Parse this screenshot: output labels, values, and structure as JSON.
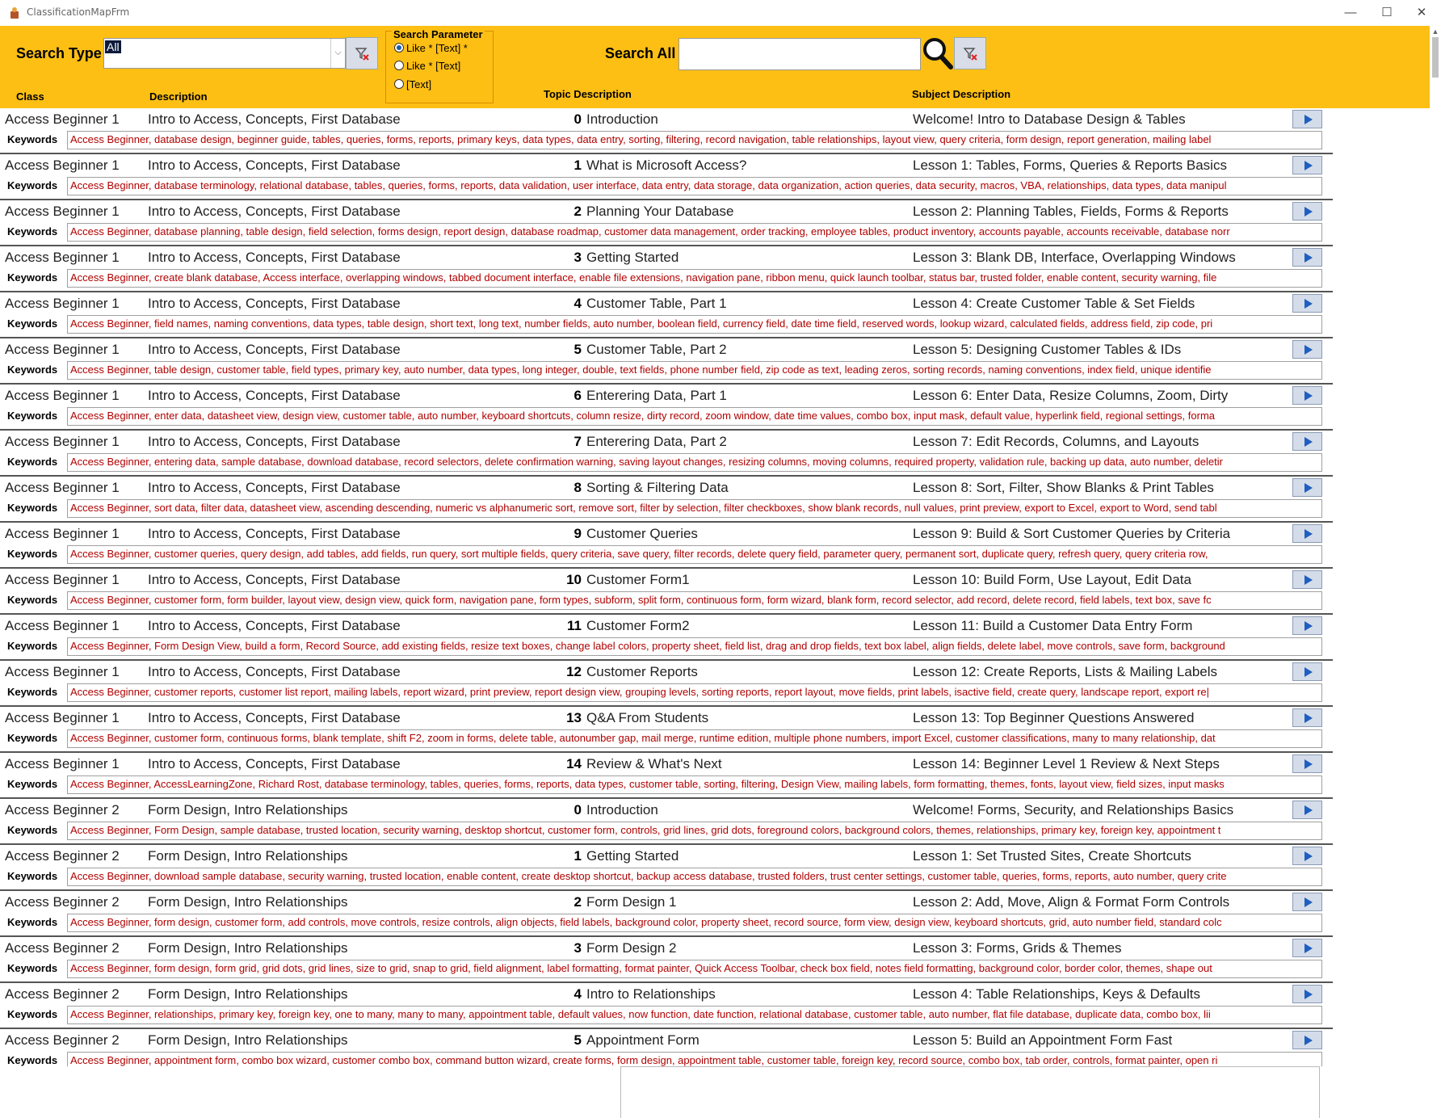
{
  "window": {
    "title": "ClassificationMapFrm",
    "minimize": "—",
    "maximize": "☐",
    "close": "✕"
  },
  "search": {
    "type_label": "Search Type",
    "type_value": "All",
    "param_title": "Search Parameter",
    "options": [
      "Like * [Text] *",
      "Like * [Text]",
      "[Text]"
    ],
    "selected_option": 0,
    "all_label": "Search All",
    "all_value": ""
  },
  "columns": {
    "class": "Class",
    "description": "Description",
    "topic": "Topic Description",
    "subject": "Subject Description"
  },
  "keywords_label": "Keywords",
  "records": [
    {
      "class": "Access Beginner 1",
      "desc": "Intro to Access, Concepts, First Database",
      "num": "0",
      "topic": "Introduction",
      "subject": "Welcome! Intro to Database Design & Tables",
      "keywords": "Access Beginner, database design, beginner guide, tables, queries, forms, reports, primary keys, data types, data entry, sorting, filtering, record navigation, table relationships, layout view, query criteria, form design, report generation, mailing label"
    },
    {
      "class": "Access Beginner 1",
      "desc": "Intro to Access, Concepts, First Database",
      "num": "1",
      "topic": "What is Microsoft Access?",
      "subject": "Lesson 1: Tables, Forms, Queries & Reports Basics",
      "keywords": "Access Beginner, database terminology, relational database, tables, queries, forms, reports, data validation, user interface, data entry, data storage, data organization, action queries, data security, macros, VBA, relationships, data types, data manipul"
    },
    {
      "class": "Access Beginner 1",
      "desc": "Intro to Access, Concepts, First Database",
      "num": "2",
      "topic": "Planning Your Database",
      "subject": "Lesson 2: Planning Tables, Fields, Forms & Reports",
      "keywords": "Access Beginner, database planning, table design, field selection, forms design, report design, database roadmap, customer data management, order tracking, employee tables, product inventory, accounts payable, accounts receivable, database norr"
    },
    {
      "class": "Access Beginner 1",
      "desc": "Intro to Access, Concepts, First Database",
      "num": "3",
      "topic": "Getting Started",
      "subject": "Lesson 3: Blank DB, Interface, Overlapping Windows",
      "keywords": "Access Beginner, create blank database, Access interface, overlapping windows, tabbed document interface, enable file extensions, navigation pane, ribbon menu, quick launch toolbar, status bar, trusted folder, enable content, security warning, file"
    },
    {
      "class": "Access Beginner 1",
      "desc": "Intro to Access, Concepts, First Database",
      "num": "4",
      "topic": "Customer Table, Part 1",
      "subject": "Lesson 4: Create Customer Table & Set Fields",
      "keywords": "Access Beginner, field names, naming conventions, data types, table design, short text, long text, number fields, auto number, boolean field, currency field, date time field, reserved words, lookup wizard, calculated fields, address field, zip code, pri"
    },
    {
      "class": "Access Beginner 1",
      "desc": "Intro to Access, Concepts, First Database",
      "num": "5",
      "topic": "Customer Table, Part 2",
      "subject": "Lesson 5: Designing Customer Tables & IDs",
      "keywords": "Access Beginner, table design, customer table, field types, primary key, auto number, data types, long integer, double, text fields, phone number field, zip code as text, leading zeros, sorting records, naming conventions, index field, unique identifie"
    },
    {
      "class": "Access Beginner 1",
      "desc": "Intro to Access, Concepts, First Database",
      "num": "6",
      "topic": "Enterering Data, Part 1",
      "subject": "Lesson 6: Enter Data, Resize Columns, Zoom, Dirty",
      "keywords": "Access Beginner, enter data, datasheet view, design view, customer table, auto number, keyboard shortcuts, column resize, dirty record, zoom window, date time values, combo box, input mask, default value, hyperlink field, regional settings, forma"
    },
    {
      "class": "Access Beginner 1",
      "desc": "Intro to Access, Concepts, First Database",
      "num": "7",
      "topic": "Enterering Data, Part 2",
      "subject": "Lesson 7: Edit Records, Columns, and Layouts",
      "keywords": "Access Beginner, entering data, sample database, download database, record selectors, delete confirmation warning, saving layout changes, resizing columns, moving columns, required property, validation rule, backing up data, auto number, deletir"
    },
    {
      "class": "Access Beginner 1",
      "desc": "Intro to Access, Concepts, First Database",
      "num": "8",
      "topic": "Sorting & Filtering Data",
      "subject": "Lesson 8: Sort, Filter, Show Blanks & Print Tables",
      "keywords": "Access Beginner, sort data, filter data, datasheet view, ascending descending, numeric vs alphanumeric sort, remove sort, filter by selection, filter checkboxes, show blank records, null values, print preview, export to Excel, export to Word, send tabl"
    },
    {
      "class": "Access Beginner 1",
      "desc": "Intro to Access, Concepts, First Database",
      "num": "9",
      "topic": "Customer Queries",
      "subject": "Lesson 9: Build & Sort Customer Queries by Criteria",
      "keywords": "Access Beginner, customer queries, query design, add tables, add fields, run query, sort multiple fields, query criteria, save query, filter records, delete query field, parameter query, permanent sort, duplicate query, refresh query, query criteria row,"
    },
    {
      "class": "Access Beginner 1",
      "desc": "Intro to Access, Concepts, First Database",
      "num": "10",
      "topic": "Customer Form1",
      "subject": "Lesson 10: Build Form, Use Layout, Edit Data",
      "keywords": "Access Beginner, customer form, form builder, layout view, design view, quick form, navigation pane, form types, subform, split form, continuous form, form wizard, blank form, record selector, add record, delete record, field labels, text box, save fc"
    },
    {
      "class": "Access Beginner 1",
      "desc": "Intro to Access, Concepts, First Database",
      "num": "11",
      "topic": "Customer Form2",
      "subject": "Lesson 11: Build a Customer Data Entry Form",
      "keywords": "Access Beginner, Form Design View, build a form, Record Source, add existing fields, resize text boxes, change label colors, property sheet, field list, drag and drop fields, text box label, align fields, delete label, move controls, save form, background"
    },
    {
      "class": "Access Beginner 1",
      "desc": "Intro to Access, Concepts, First Database",
      "num": "12",
      "topic": "Customer Reports",
      "subject": "Lesson 12: Create Reports, Lists & Mailing Labels",
      "keywords": "Access Beginner, customer reports, customer list report, mailing labels, report wizard, print preview, report design view, grouping levels, sorting reports, report layout, move fields, print labels, isactive field, create query, landscape report, export re|"
    },
    {
      "class": "Access Beginner 1",
      "desc": "Intro to Access, Concepts, First Database",
      "num": "13",
      "topic": "Q&A From Students",
      "subject": "Lesson 13: Top Beginner Questions Answered",
      "keywords": "Access Beginner, customer form, continuous forms, blank template, shift F2, zoom in forms, delete table, autonumber gap, mail merge, runtime edition, multiple phone numbers, import Excel, customer classifications, many to many relationship, dat"
    },
    {
      "class": "Access Beginner 1",
      "desc": "Intro to Access, Concepts, First Database",
      "num": "14",
      "topic": "Review & What's Next",
      "subject": "Lesson 14: Beginner Level 1 Review & Next Steps",
      "keywords": "Access Beginner, AccessLearningZone, Richard Rost, database terminology, tables, queries, forms, reports, data types, customer table, sorting, filtering, Design View, mailing labels, form formatting, themes, fonts, layout view, field sizes, input masks"
    },
    {
      "class": "Access Beginner 2",
      "desc": "Form Design, Intro Relationships",
      "num": "0",
      "topic": "Introduction",
      "subject": "Welcome! Forms, Security, and Relationships Basics",
      "keywords": "Access Beginner, Form Design, sample database, trusted location, security warning, desktop shortcut, customer form, controls, grid lines, grid dots, foreground colors, background colors, themes, relationships, primary key, foreign key, appointment t"
    },
    {
      "class": "Access Beginner 2",
      "desc": "Form Design, Intro Relationships",
      "num": "1",
      "topic": "Getting Started",
      "subject": "Lesson 1: Set Trusted Sites, Create Shortcuts",
      "keywords": "Access Beginner, download sample database, security warning, trusted location, enable content, create desktop shortcut, backup access database, trusted folders, trust center settings, customer table, queries, forms, reports, auto number, query crite"
    },
    {
      "class": "Access Beginner 2",
      "desc": "Form Design, Intro Relationships",
      "num": "2",
      "topic": "Form Design 1",
      "subject": "Lesson 2: Add, Move, Align & Format Form Controls",
      "keywords": "Access Beginner, form design, customer form, add controls, move controls, resize controls, align objects, field labels, background color, property sheet, record source, form view, design view, keyboard shortcuts, grid, auto number field, standard colc"
    },
    {
      "class": "Access Beginner 2",
      "desc": "Form Design, Intro Relationships",
      "num": "3",
      "topic": "Form Design 2",
      "subject": "Lesson 3: Forms, Grids & Themes",
      "keywords": "Access Beginner, form design, form grid, grid dots, grid lines, size to grid, snap to grid, field alignment, label formatting, format painter, Quick Access Toolbar, check box field, notes field formatting, background color, border color, themes, shape out"
    },
    {
      "class": "Access Beginner 2",
      "desc": "Form Design, Intro Relationships",
      "num": "4",
      "topic": "Intro to Relationships",
      "subject": "Lesson 4: Table Relationships, Keys & Defaults",
      "keywords": "Access Beginner, relationships, primary key, foreign key, one to many, many to many, appointment table, default values, now function, date function, relational database, customer table, auto number, flat file database, duplicate data, combo box, lii"
    },
    {
      "class": "Access Beginner 2",
      "desc": "Form Design, Intro Relationships",
      "num": "5",
      "topic": "Appointment Form",
      "subject": "Lesson 5: Build an Appointment Form Fast",
      "keywords": "Access Beginner, appointment form, combo box wizard, customer combo box, command button wizard, create forms, form design, appointment table, customer table, foreign key, record source, combo box, tab order, controls, format painter, open ri"
    }
  ]
}
